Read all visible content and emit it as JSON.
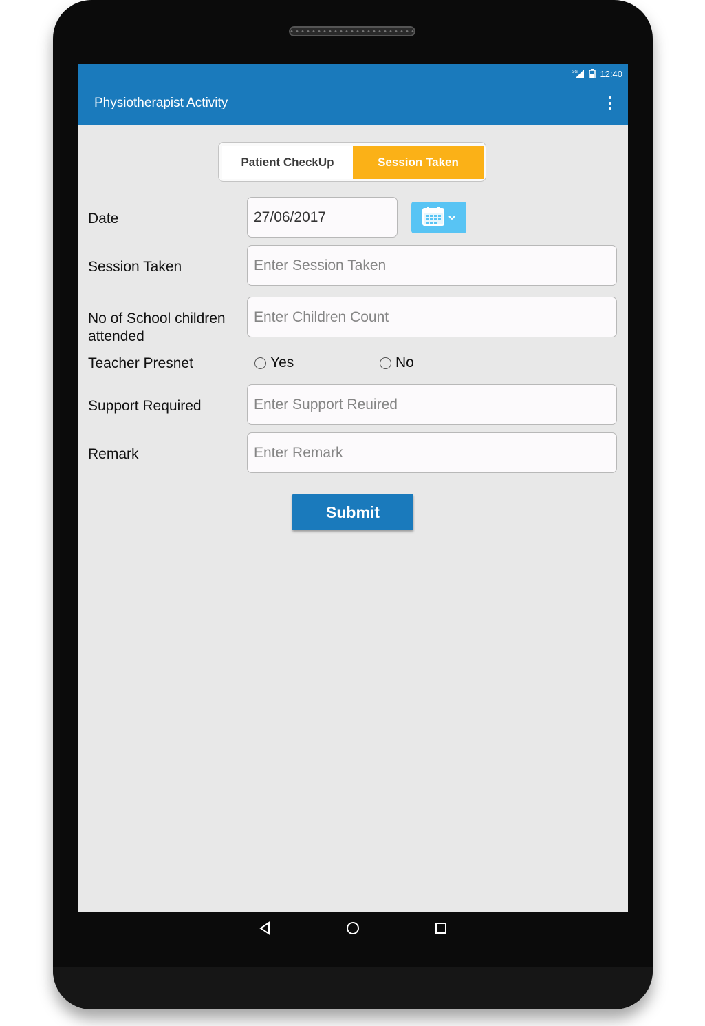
{
  "status_bar": {
    "network": "3G",
    "time": "12:40"
  },
  "appbar": {
    "title": "Physiotherapist Activity",
    "menu_icon": "overflow-menu-icon"
  },
  "tabs": [
    {
      "label": "Patient CheckUp",
      "selected": false
    },
    {
      "label": "Session Taken",
      "selected": true
    }
  ],
  "form": {
    "date": {
      "label": "Date",
      "value": "27/06/2017",
      "calendar_icon": "calendar-icon"
    },
    "session_taken": {
      "label": "Session Taken",
      "placeholder": "Enter Session Taken"
    },
    "children_count": {
      "label": "No of School children attended",
      "placeholder": "Enter Children Count"
    },
    "teacher_present": {
      "label": "Teacher Presnet",
      "options": [
        {
          "label": "Yes",
          "checked": false
        },
        {
          "label": "No",
          "checked": false
        }
      ]
    },
    "support_required": {
      "label": "Support Required",
      "placeholder": "Enter Support Reuired"
    },
    "remark": {
      "label": "Remark",
      "placeholder": "Enter Remark"
    },
    "submit_label": "Submit"
  },
  "colors": {
    "primary": "#1a7abc",
    "accent": "#fbb117",
    "calendar_button": "#58c4f4"
  },
  "navigation": [
    "back-icon",
    "home-icon",
    "recents-icon"
  ]
}
